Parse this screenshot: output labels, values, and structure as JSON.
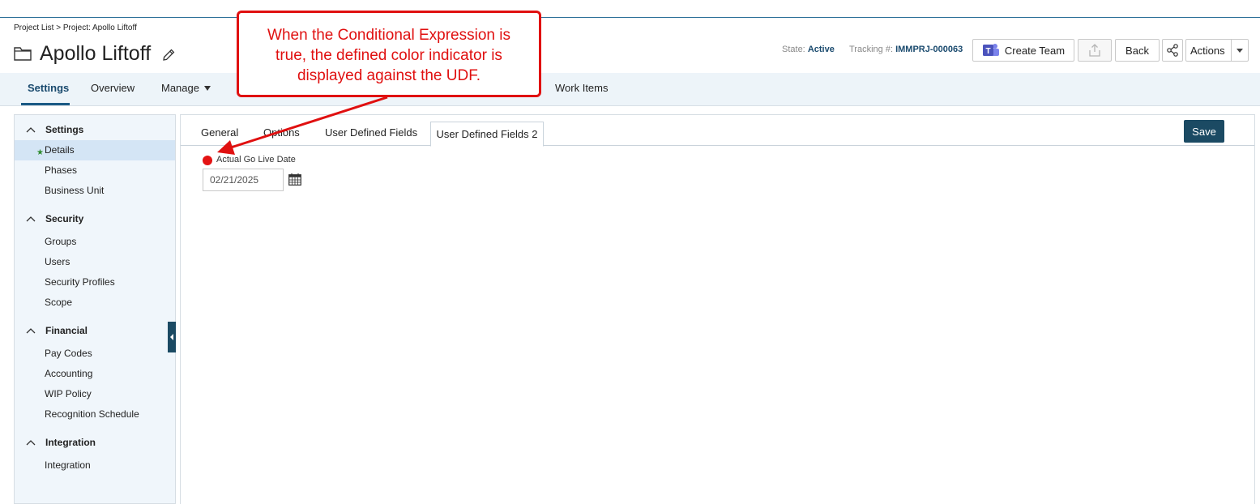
{
  "breadcrumb": {
    "project_list": "Project List",
    "separator": ">",
    "current": "Project: Apollo Liftoff"
  },
  "header": {
    "title": "Apollo Liftoff",
    "state_label": "State:",
    "state_value": "Active",
    "tracking_label": "Tracking #:",
    "tracking_value": "IMMPRJ-000063",
    "create_team_label": "Create Team",
    "back_label": "Back",
    "actions_label": "Actions"
  },
  "nav": {
    "tabs": [
      {
        "label": "Settings",
        "active": true
      },
      {
        "label": "Overview"
      },
      {
        "label": "Manage"
      },
      {
        "label": "Work Items"
      }
    ]
  },
  "sidebar": {
    "sections": [
      {
        "title": "Settings",
        "items": [
          "Details",
          "Phases",
          "Business Unit"
        ]
      },
      {
        "title": "Security",
        "items": [
          "Groups",
          "Users",
          "Security Profiles",
          "Scope"
        ]
      },
      {
        "title": "Financial",
        "items": [
          "Pay Codes",
          "Accounting",
          "WIP Policy",
          "Recognition Schedule"
        ]
      },
      {
        "title": "Integration",
        "items": [
          "Integration"
        ]
      }
    ],
    "active_item": "Details",
    "active_marker": "★"
  },
  "content": {
    "tabs": [
      "General",
      "Options",
      "User Defined Fields",
      "User Defined Fields 2"
    ],
    "active_tab": "User Defined Fields 2",
    "save_label": "Save",
    "field": {
      "label": "Actual Go Live Date",
      "value": "02/21/2025",
      "indicator_color": "#e41313"
    }
  },
  "callout": {
    "text_line1": "When the Conditional Expression is",
    "text_line2": "true, the defined  color indicator is",
    "text_line3": "displayed against the UDF.",
    "color": "#e01010"
  },
  "colors": {
    "accent": "#1b4a63",
    "nav_bg": "#edf4f9",
    "sidebar_bg": "#f0f6fb",
    "active_item_bg": "#d4e5f5"
  }
}
